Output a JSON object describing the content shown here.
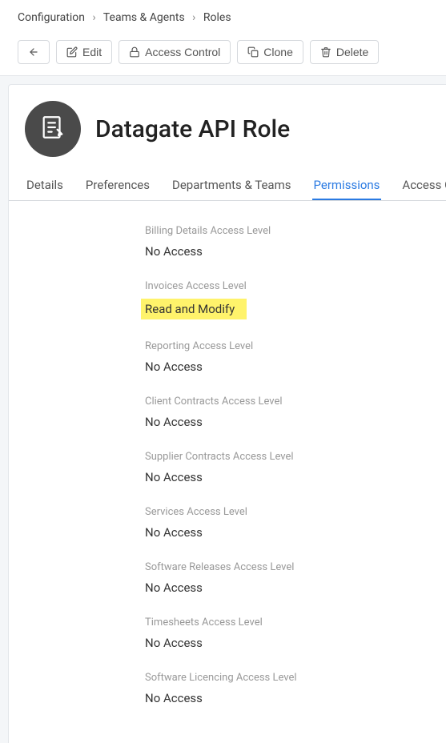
{
  "breadcrumb": {
    "items": [
      "Configuration",
      "Teams & Agents",
      "Roles"
    ]
  },
  "toolbar": {
    "back_label": "",
    "edit_label": "Edit",
    "access_control_label": "Access Control",
    "clone_label": "Clone",
    "delete_label": "Delete"
  },
  "page_title": "Datagate API Role",
  "tabs": [
    {
      "label": "Details",
      "active": false
    },
    {
      "label": "Preferences",
      "active": false
    },
    {
      "label": "Departments & Teams",
      "active": false
    },
    {
      "label": "Permissions",
      "active": true
    },
    {
      "label": "Access C",
      "active": false
    }
  ],
  "permissions": [
    {
      "label": "Billing Details Access Level",
      "value": "No Access",
      "highlight": false
    },
    {
      "label": "Invoices Access Level",
      "value": "Read and Modify",
      "highlight": true
    },
    {
      "label": "Reporting Access Level",
      "value": "No Access",
      "highlight": false
    },
    {
      "label": "Client Contracts Access Level",
      "value": "No Access",
      "highlight": false
    },
    {
      "label": "Supplier Contracts Access Level",
      "value": "No Access",
      "highlight": false
    },
    {
      "label": "Services Access Level",
      "value": "No Access",
      "highlight": false
    },
    {
      "label": "Software Releases Access Level",
      "value": "No Access",
      "highlight": false
    },
    {
      "label": "Timesheets Access Level",
      "value": "No Access",
      "highlight": false
    },
    {
      "label": "Software Licencing Access Level",
      "value": "No Access",
      "highlight": false
    }
  ]
}
